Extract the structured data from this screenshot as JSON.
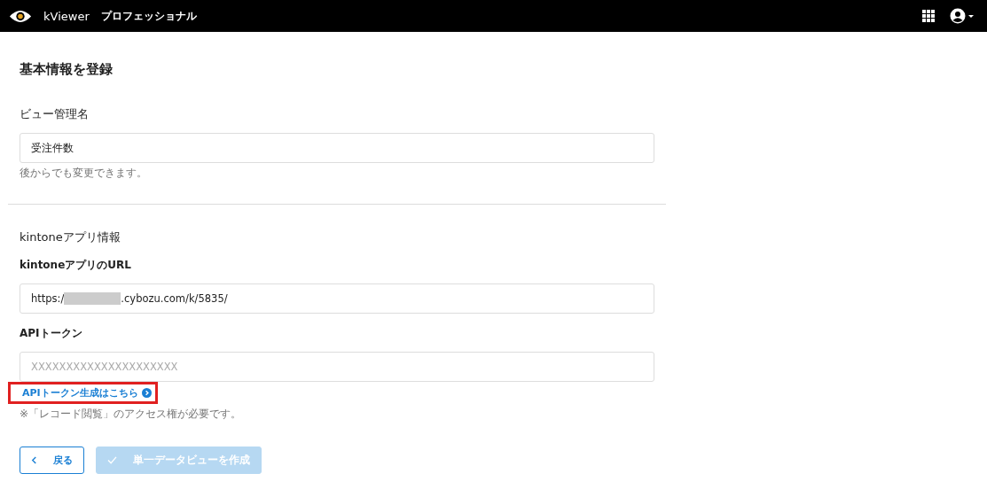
{
  "header": {
    "app_name": "kViewer",
    "edition": "プロフェッショナル"
  },
  "title": "基本情報を登録",
  "view_name": {
    "label": "ビュー管理名",
    "value": "受注件数",
    "hint": "後からでも変更できます。"
  },
  "kintone": {
    "section": "kintoneアプリ情報",
    "url": {
      "label": "kintoneアプリのURL",
      "value_start": "https:/",
      "redacted": true,
      "value_end": ".cybozu.com/k/5835/"
    },
    "token": {
      "label": "APIトークン",
      "placeholder": "XXXXXXXXXXXXXXXXXXXXX"
    },
    "token_link": {
      "text": "APIトークン生成はこちら",
      "highlighted": true
    },
    "note": "※「レコード閲覧」のアクセス権が必要です。"
  },
  "buttons": [
    {
      "kind": "back",
      "label": "戻る",
      "disabled": false
    },
    {
      "kind": "create",
      "label": "単一データビューを作成",
      "disabled": true
    }
  ]
}
